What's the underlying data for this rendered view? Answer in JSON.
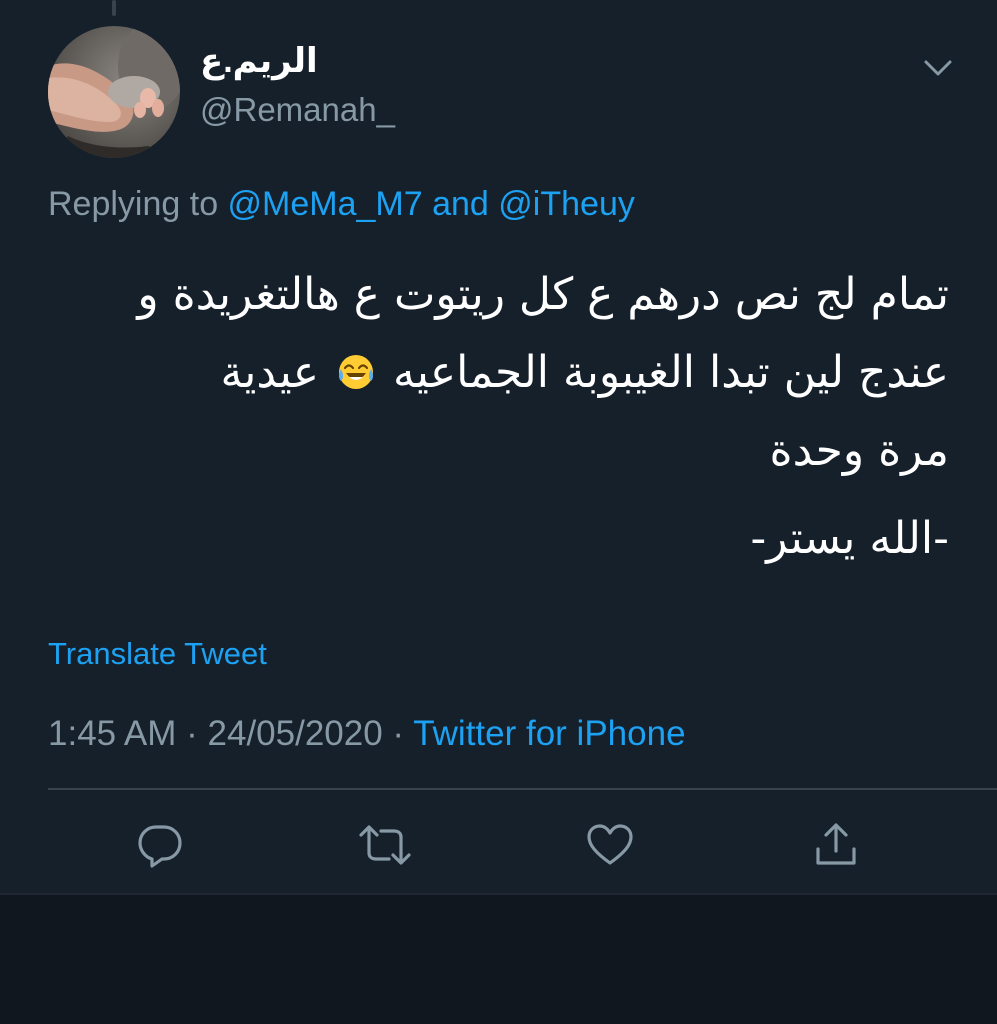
{
  "author": {
    "display_name": "الريم.ع",
    "handle": "@Remanah_"
  },
  "reply": {
    "prefix": "Replying to ",
    "mention_1": "@MeMa_M7",
    "connector": " and ",
    "mention_2": "@iTheuy"
  },
  "tweet": {
    "line_1": "تمام لج نص درهم ع كل ريتوت ع هالتغريدة و",
    "line_2_a": "عندج لين تبدا الغيبوبة الجماعيه",
    "line_2_b": "عيدية",
    "line_3": "مرة وحدة",
    "signature": "-الله يستر-",
    "emoji": "face-with-tears-of-joy"
  },
  "translate_label": "Translate Tweet",
  "meta": {
    "time": "1:45 AM",
    "separator": " · ",
    "date": "24/05/2020",
    "source": "Twitter for iPhone"
  },
  "actions": {
    "icons": [
      "reply-icon",
      "retweet-icon",
      "like-icon",
      "share-icon"
    ]
  },
  "colors": {
    "background": "#15202b",
    "accent": "#1da1f2",
    "secondary_text": "#8899a6",
    "divider": "#38444d"
  }
}
